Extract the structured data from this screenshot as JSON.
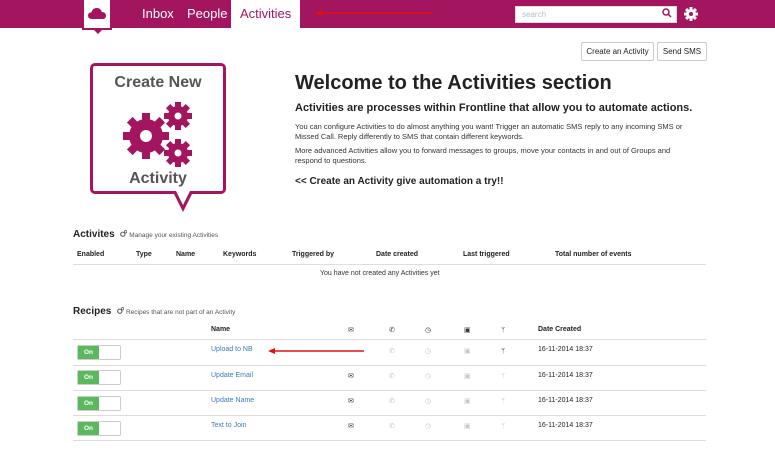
{
  "nav": {
    "items": [
      {
        "label": "Inbox"
      },
      {
        "label": "People"
      },
      {
        "label": "Activities"
      }
    ],
    "search_placeholder": "search"
  },
  "toolbar": {
    "create_activity": "Create an Activity",
    "send_sms": "Send SMS"
  },
  "hero": {
    "card_line1": "Create New",
    "card_line2": "Activity",
    "title": "Welcome to the Activities section",
    "subtitle": "Activities are processes within Frontline that allow you to automate actions.",
    "para1": "You can configure Activities to do almost anything you want! Trigger an automatic SMS reply to any incoming SMS or Missed Call. Reply differently to SMS that contain different keywords.",
    "para2": "More advanced Activities allow you to forward messages to groups, move your contacts in and out of Groups and respond to questions.",
    "cta": "<< Create an Activity give automation a try!!"
  },
  "activities": {
    "title": "Activites",
    "subtitle": "Manage your existing Activities",
    "columns": [
      "Enabled",
      "Type",
      "Name",
      "Keywords",
      "Triggered by",
      "Date created",
      "Last triggered",
      "Total number of events"
    ],
    "empty": "You have not created any Activities yet"
  },
  "recipes": {
    "title": "Recipes",
    "subtitle": "Recipes that are not part of an Activity",
    "col_name": "Name",
    "col_date": "Date Created",
    "rows": [
      {
        "toggle": "On",
        "name": "Upload to NB",
        "date": "16-11-2014 18:37"
      },
      {
        "toggle": "On",
        "name": "Update Email",
        "date": "16-11-2014 18:37"
      },
      {
        "toggle": "On",
        "name": "Update Name",
        "date": "16-11-2014 18:37"
      },
      {
        "toggle": "On",
        "name": "Text to Join",
        "date": "16-11-2014 18:37"
      }
    ]
  },
  "colors": {
    "brand": "#a3165f",
    "on": "#5cb85c",
    "link": "#3a7bbf",
    "arrow": "#e01010"
  }
}
